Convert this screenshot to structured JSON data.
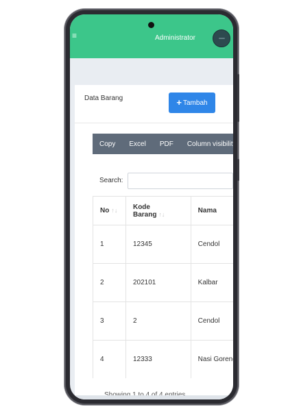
{
  "header": {
    "admin_label": "Administrator"
  },
  "card": {
    "title": "Data Barang",
    "add_label": "Tambah"
  },
  "export_buttons": [
    "Copy",
    "Excel",
    "PDF",
    "Column visibility"
  ],
  "search": {
    "label": "Search:",
    "value": "",
    "placeholder": ""
  },
  "table": {
    "headers": [
      "No",
      "Kode Barang",
      "Nama"
    ],
    "rows": [
      [
        "1",
        "12345",
        "Cendol"
      ],
      [
        "2",
        "202101",
        "Kalbar"
      ],
      [
        "3",
        "2",
        "Cendol"
      ],
      [
        "4",
        "12333",
        "Nasi Goreng"
      ]
    ]
  },
  "footer": {
    "info": "Showing 1 to 4 of 4 entries"
  },
  "colors": {
    "header_bg": "#3cc68a",
    "primary_button": "#2f86e8",
    "export_bar": "#5f6b7a"
  }
}
